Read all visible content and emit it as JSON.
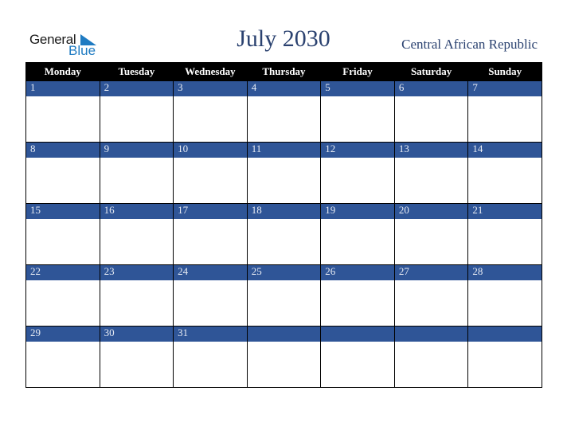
{
  "logo": {
    "line1": "General",
    "line2": "Blue"
  },
  "title": "July 2030",
  "country": "Central African Republic",
  "weekdays": [
    "Monday",
    "Tuesday",
    "Wednesday",
    "Thursday",
    "Friday",
    "Saturday",
    "Sunday"
  ],
  "weeks": [
    [
      "1",
      "2",
      "3",
      "4",
      "5",
      "6",
      "7"
    ],
    [
      "8",
      "9",
      "10",
      "11",
      "12",
      "13",
      "14"
    ],
    [
      "15",
      "16",
      "17",
      "18",
      "19",
      "20",
      "21"
    ],
    [
      "22",
      "23",
      "24",
      "25",
      "26",
      "27",
      "28"
    ],
    [
      "29",
      "30",
      "31",
      "",
      "",
      "",
      ""
    ]
  ],
  "colors": {
    "header_bg": "#000000",
    "day_bar": "#2f5597",
    "title": "#2b4270",
    "logo_blue": "#1f7bc2"
  }
}
